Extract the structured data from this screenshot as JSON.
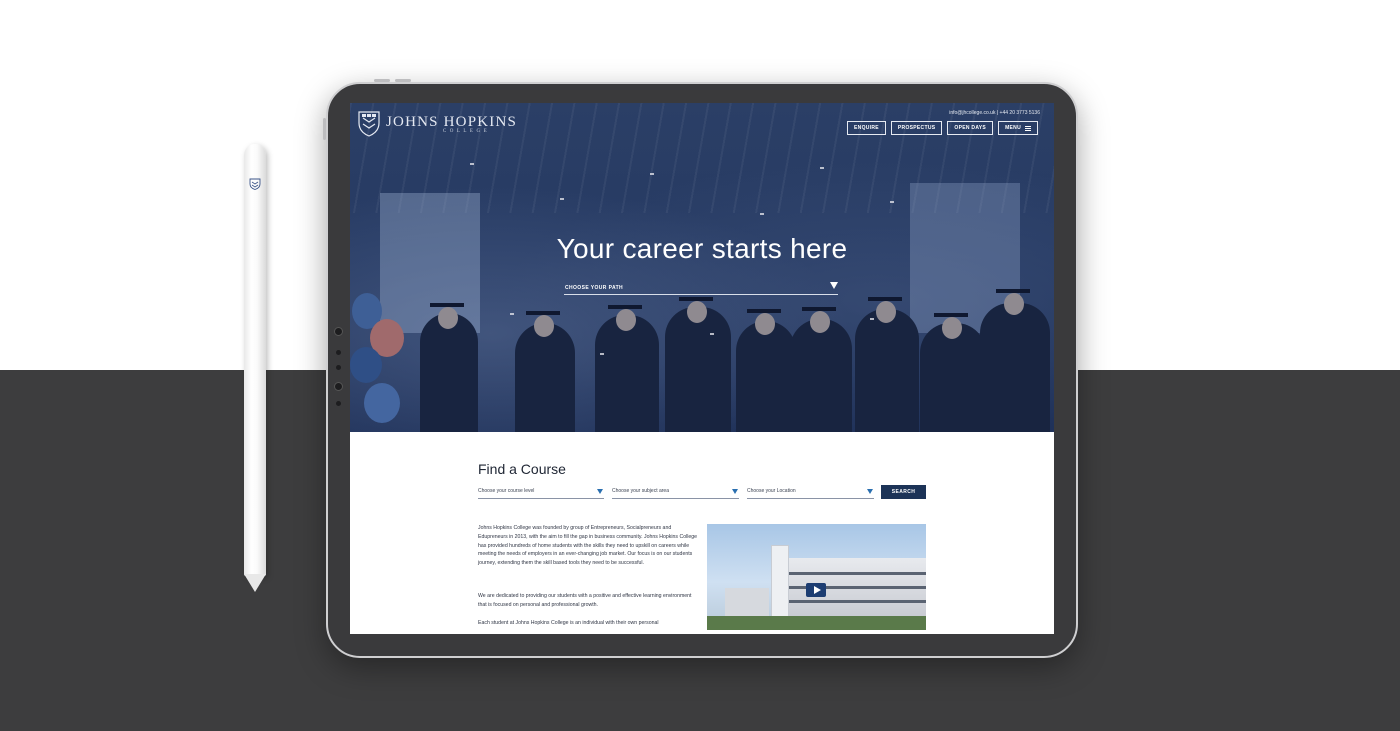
{
  "site": {
    "logo_name": "JOHNS HOPKINS",
    "logo_sub": "COLLEGE",
    "contact": "info@jhcollege.co.uk | +44 20 3773 5136"
  },
  "nav": {
    "items": [
      {
        "label": "ENQUIRE"
      },
      {
        "label": "PROSPECTUS"
      },
      {
        "label": "OPEN DAYS"
      },
      {
        "label": "MENU"
      }
    ]
  },
  "hero": {
    "title": "Your career starts here",
    "path_placeholder": "CHOOSE YOUR PATH"
  },
  "find_course": {
    "title": "Find a Course",
    "level_placeholder": "Choose your course level",
    "subject_placeholder": "Choose your subject area",
    "location_placeholder": "Choose your Location",
    "search_label": "SEARCH"
  },
  "about": {
    "paragraphs": [
      "Johns Hopkins College was founded by group of Entrepreneurs, Socialpreneurs and Edupreneurs in 2013, with the aim to fill the gap in business community. Johns Hopkins College has provided hundreds of home students with the skills they need to upskill on careers while meeting the needs of employers in an ever-changing job market. Our focus is on our students journey, extending them the skill based tools they need to be successful.",
      "We are dedicated to providing our students with a positive and effective learning environment that is focused on personal and professional growth.",
      "Each student at Johns Hopkins College is an individual with their own personal"
    ]
  },
  "icons": {
    "crest": "crest-icon",
    "menu": "hamburger-icon",
    "caret": "caret-down-icon",
    "play": "play-icon"
  },
  "colors": {
    "brand_navy": "#1c3357",
    "hero_overlay": "#263a63",
    "accent_blue": "#2a6fb0",
    "device_frame": "#3a3a3c"
  }
}
